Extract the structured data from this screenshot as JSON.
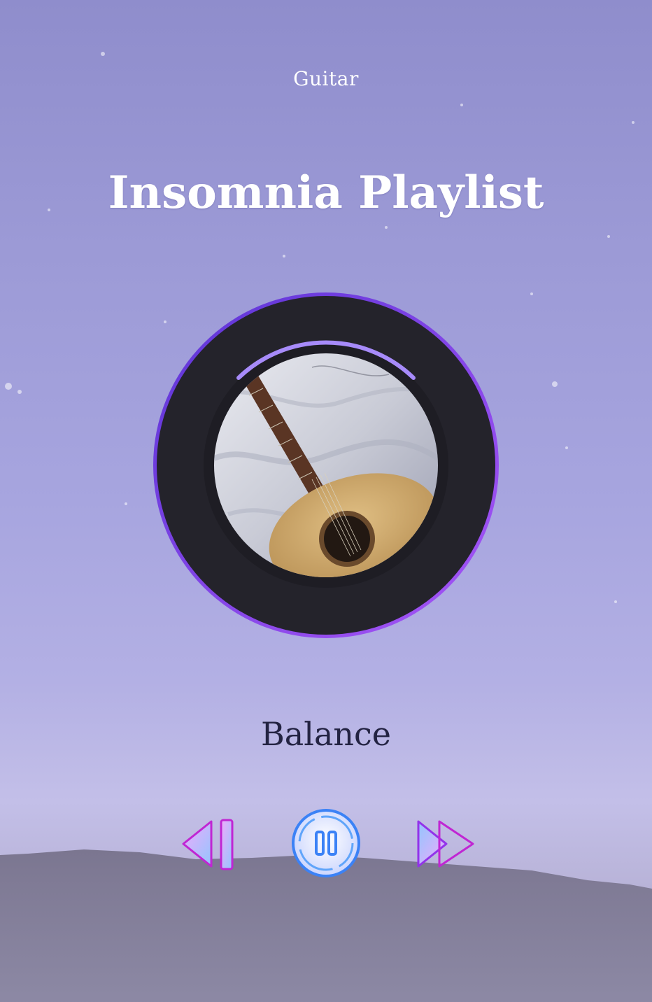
{
  "player": {
    "category": "Guitar",
    "playlist_title": "Insomnia Playlist",
    "track_title": "Balance",
    "progress": 0.18,
    "state": "playing"
  },
  "controls": {
    "previous_icon": "skip-previous-icon",
    "pause_icon": "pause-icon",
    "next_icon": "fast-forward-icon"
  },
  "colors": {
    "accent_purple": "#8b5cf6",
    "accent_blue": "#4f46e5",
    "disc": "#24232b",
    "control_pink": "#e879f9",
    "control_blue": "#60a5fa"
  }
}
